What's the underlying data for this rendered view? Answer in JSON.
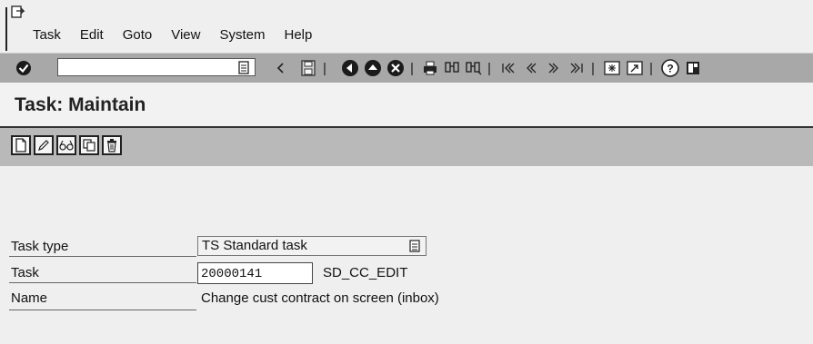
{
  "menu": {
    "items": [
      "Task",
      "Edit",
      "Goto",
      "View",
      "System",
      "Help"
    ]
  },
  "toolbar": {
    "command_field_value": ""
  },
  "page": {
    "title": "Task: Maintain"
  },
  "form": {
    "task_type": {
      "label": "Task type",
      "value": "TS Standard task"
    },
    "task": {
      "label": "Task",
      "value": "20000141",
      "abbreviation": "SD_CC_EDIT"
    },
    "name": {
      "label": "Name",
      "value": "Change cust contract on screen (inbox)"
    }
  }
}
